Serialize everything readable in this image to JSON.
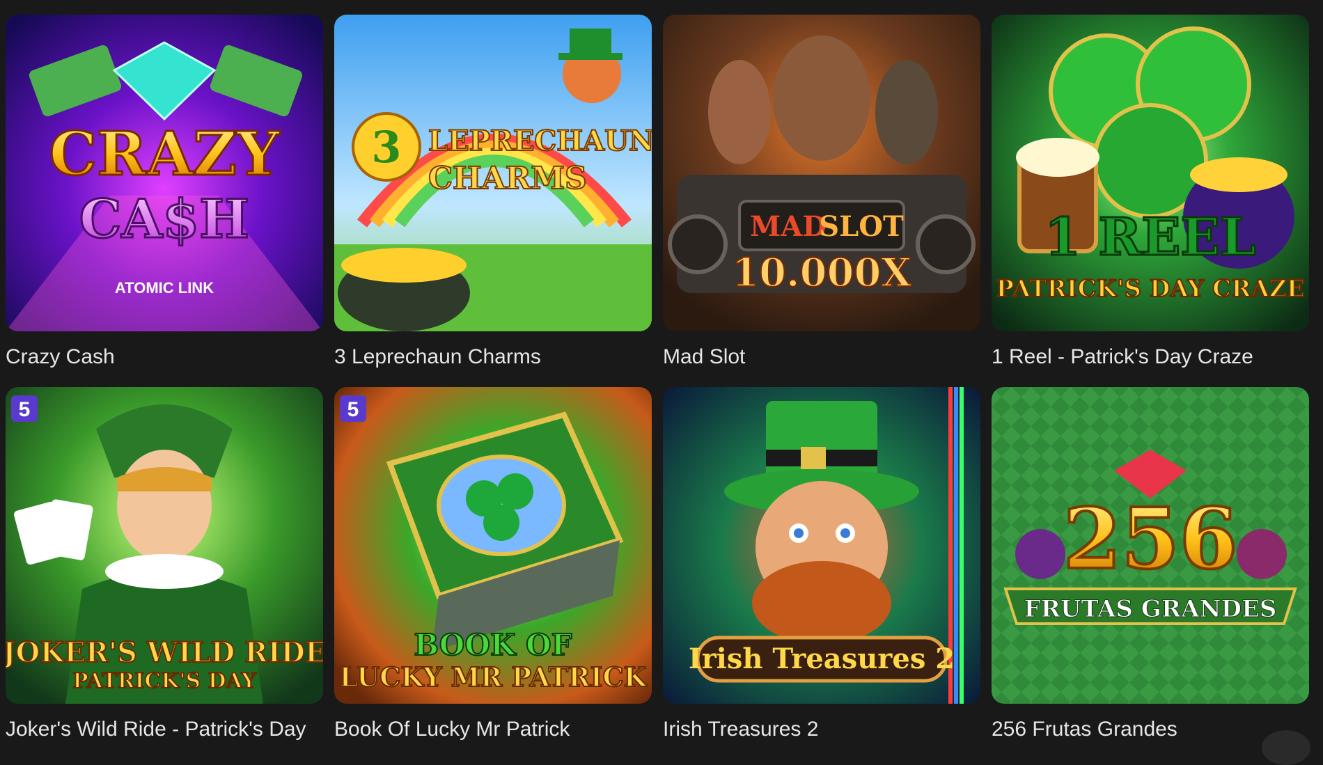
{
  "colors": {
    "background": "#191919",
    "title_text": "#e6e6e6"
  },
  "games": [
    {
      "title": "Crazy Cash",
      "art_line1": "CRAZY",
      "art_line2": "CA$H",
      "art_sub": "ATOMIC LINK",
      "icon": "diamond-icon"
    },
    {
      "title": "3 Leprechaun Charms",
      "art_number": "3",
      "art_line1": "LEPRECHAUN",
      "art_line2": "CHARMS",
      "icon": "leprechaun-icon"
    },
    {
      "title": "Mad Slot",
      "art_line1_a": "MAD",
      "art_line1_b": "SLOT",
      "art_line2": "10.000X",
      "icon": "warriors-icon"
    },
    {
      "title": "1 Reel - Patrick's Day Craze",
      "art_line1": "1 REEL",
      "art_line2": "PATRICK'S DAY CRAZE",
      "icon": "clover-icon"
    },
    {
      "title": "Joker's Wild Ride - Patrick's Day",
      "art_line1": "JOKER'S WILD RIDE",
      "art_line2": "PATRICK'S DAY",
      "provider_badge": "5",
      "icon": "jester-icon"
    },
    {
      "title": "Book Of Lucky Mr Patrick",
      "art_line1": "BOOK OF",
      "art_line2": "LUCKY MR PATRICK",
      "provider_badge": "5",
      "icon": "book-icon"
    },
    {
      "title": "Irish Treasures 2",
      "art_line1": "Irish Treasures 2",
      "icon": "leprechaun-face-icon"
    },
    {
      "title": "256 Frutas Grandes",
      "art_line1": "256",
      "art_line2": "FRUTAS GRANDES",
      "icon": "fruits-icon"
    }
  ]
}
